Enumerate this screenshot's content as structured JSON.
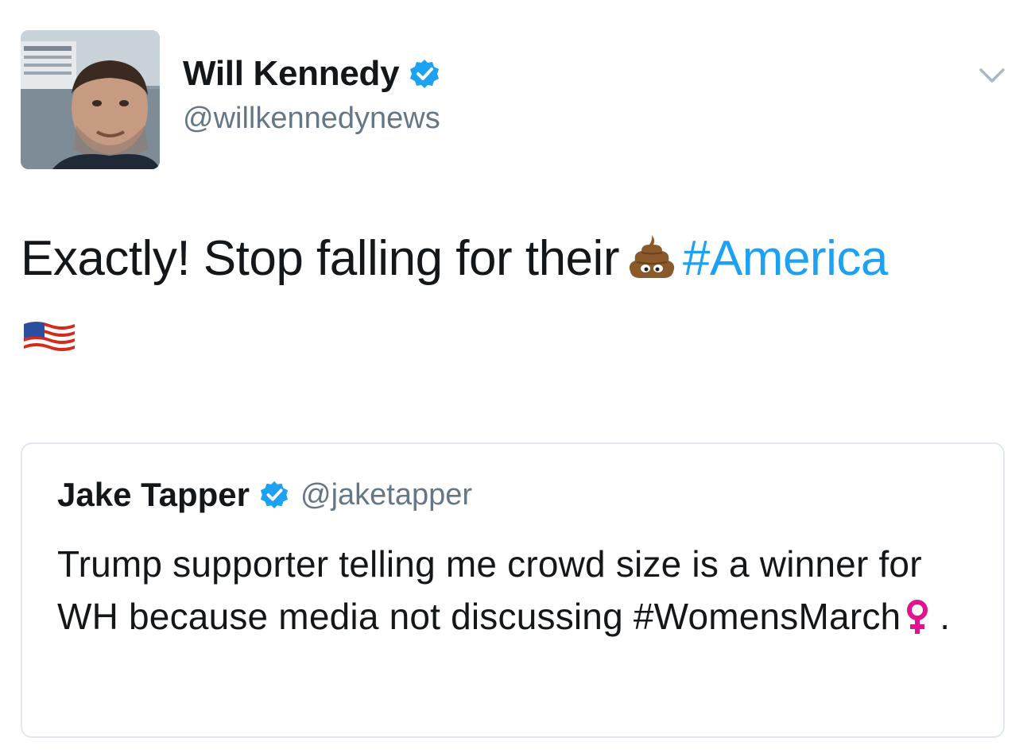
{
  "author": {
    "display_name": "Will Kennedy",
    "handle": "@willkennedynews",
    "verified": true
  },
  "tweet": {
    "text_before": "Exactly! Stop falling for their",
    "emoji_1": "pile-of-poo",
    "hashtag": "#America",
    "emoji_2": "us-flag"
  },
  "quoted_tweet": {
    "display_name": "Jake Tapper",
    "handle": "@jaketapper",
    "verified": true,
    "text": "Trump supporter telling me crowd size is a winner for WH because media not discussing",
    "hashtag": "#WomensMarch",
    "emoji": "female-sign",
    "trailing": " ."
  },
  "colors": {
    "link": "#1da1f2",
    "verified": "#1da1f2",
    "secondary_text": "#657786",
    "border": "#e1e8ed",
    "female_sign": "#e0148c"
  }
}
